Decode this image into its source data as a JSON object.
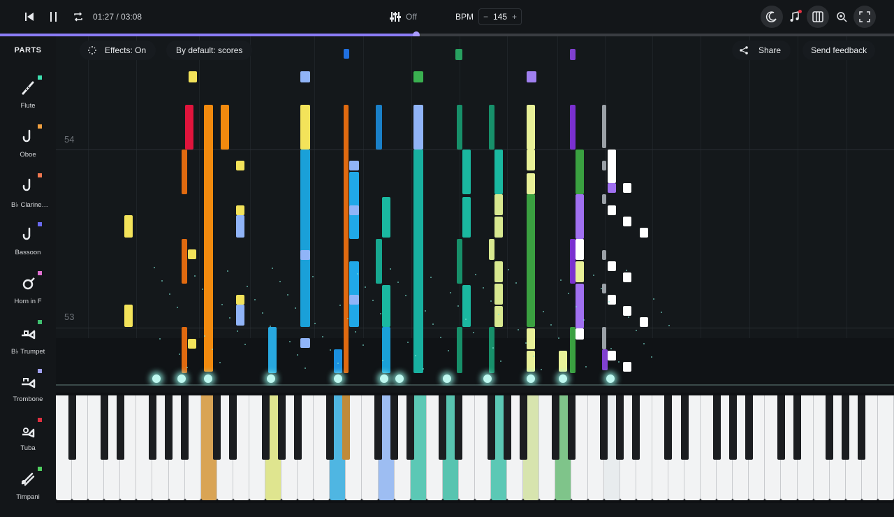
{
  "player": {
    "time": "01:27 / 03:08",
    "progress_fraction": 0.466,
    "mixer_label": "Off",
    "bpm_label": "BPM",
    "bpm_value": "145",
    "bpm_minus": "−",
    "bpm_plus": "+"
  },
  "toolbar": {
    "effects_label": "Effects: On",
    "default_label": "By default: scores",
    "share_label": "Share",
    "feedback_label": "Send feedback"
  },
  "sidebar": {
    "title": "PARTS",
    "parts": [
      {
        "label": "Flute",
        "color": "#3ee0b0"
      },
      {
        "label": "Oboe",
        "color": "#f0a040"
      },
      {
        "label": "B♭ Clarine…",
        "color": "#f07850"
      },
      {
        "label": "Bassoon",
        "color": "#6a6af0"
      },
      {
        "label": "Horn in F",
        "color": "#e070d0"
      },
      {
        "label": "B♭ Trumpet",
        "color": "#40c070"
      },
      {
        "label": "Trombone",
        "color": "#a0a0f0"
      },
      {
        "label": "Tuba",
        "color": "#e03040"
      },
      {
        "label": "Timpani",
        "color": "#50d060"
      }
    ]
  },
  "roll": {
    "measures": [
      "54",
      "53"
    ]
  },
  "colors": {
    "accent": "#8b7cf6",
    "background": "#131619"
  }
}
